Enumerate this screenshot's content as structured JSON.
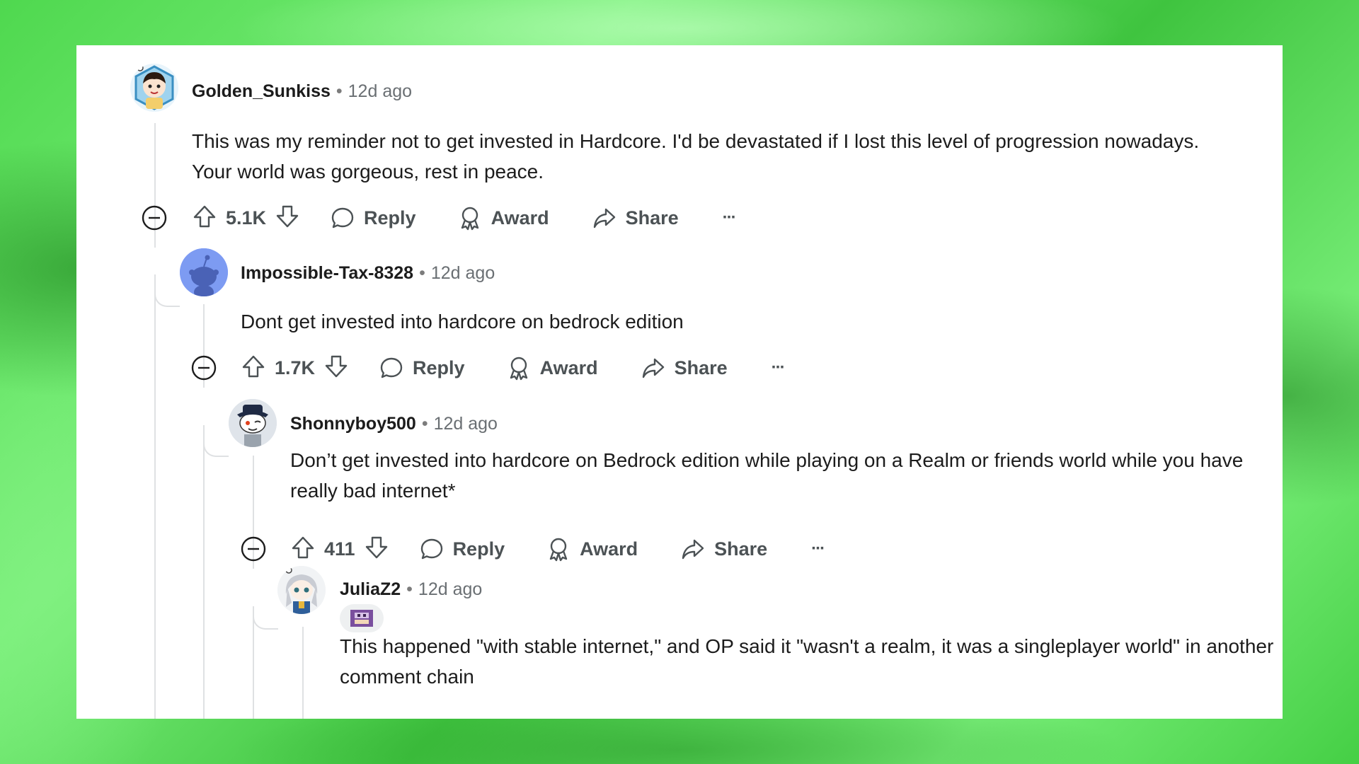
{
  "comments": [
    {
      "username": "Golden_Sunkiss",
      "time": "12d ago",
      "body": "This was my reminder not to get invested in Hardcore. I'd be devastated if I lost this level of progression nowadays. Your world was gorgeous, rest in peace.",
      "score": "5.1K",
      "reply_label": "Reply",
      "award_label": "Award",
      "share_label": "Share",
      "more_label": "···",
      "avatar_icon": "snoo-avatar-icon"
    },
    {
      "username": "Impossible-Tax-8328",
      "time": "12d ago",
      "body": "Dont get invested into hardcore on bedrock edition",
      "score": "1.7K",
      "reply_label": "Reply",
      "award_label": "Award",
      "share_label": "Share",
      "more_label": "···",
      "avatar_icon": "default-snoo-avatar-icon"
    },
    {
      "username": "Shonnyboy500",
      "time": "12d ago",
      "body": "Don’t get invested into hardcore on Bedrock edition while playing on a Realm or friends world while you have really bad internet*",
      "score": "411",
      "reply_label": "Reply",
      "award_label": "Award",
      "share_label": "Share",
      "more_label": "···",
      "avatar_icon": "snoo-hat-avatar-icon"
    },
    {
      "username": "JuliaZ2",
      "time": "12d ago",
      "flair_icon": "pixel-character-flair-icon",
      "body": "This happened \"with stable internet,\" and OP said it \"wasn't a realm, it was a singleplayer world\" in another comment chain",
      "avatar_icon": "snoo-anime-avatar-icon"
    }
  ],
  "colors": {
    "text": "#1c1c1c",
    "meta": "#6a6f73",
    "action": "#4c5255",
    "thread": "#dfe1e3",
    "background_green": "#5fe05f"
  }
}
